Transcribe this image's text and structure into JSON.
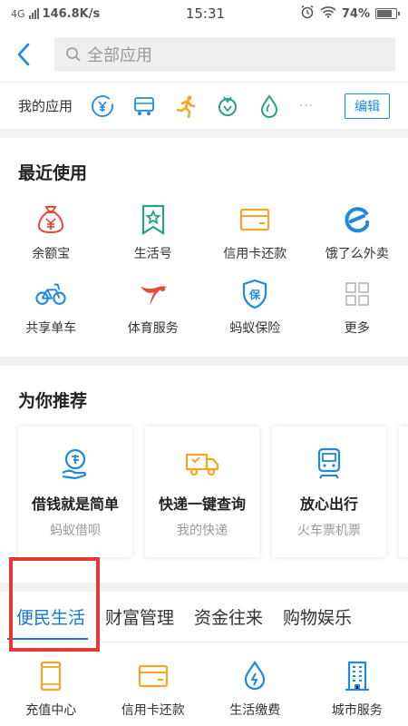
{
  "status": {
    "network": "4G",
    "speed": "146.8K/s",
    "time": "15:31",
    "battery": "74%"
  },
  "header": {
    "search_placeholder": "全部应用"
  },
  "myapps": {
    "label": "我的应用",
    "icons": [
      "yen-icon",
      "bus-card-icon",
      "runner-icon",
      "food-icon",
      "leaf-drop-icon"
    ],
    "more": "···",
    "edit_label": "编辑"
  },
  "recent": {
    "title": "最近使用",
    "items": [
      {
        "label": "余额宝",
        "icon": "money-bag-icon"
      },
      {
        "label": "生活号",
        "icon": "bookmark-star-icon"
      },
      {
        "label": "信用卡还款",
        "icon": "credit-card-icon"
      },
      {
        "label": "饿了么外卖",
        "icon": "eleme-icon"
      },
      {
        "label": "共享单车",
        "icon": "bicycle-icon"
      },
      {
        "label": "体育服务",
        "icon": "sports-icon"
      },
      {
        "label": "蚂蚁保险",
        "icon": "shield-icon"
      },
      {
        "label": "更多",
        "icon": "grid-more-icon"
      }
    ]
  },
  "recommend": {
    "title": "为你推荐",
    "cards": [
      {
        "title": "借钱就是简单",
        "subtitle": "蚂蚁借呗",
        "icon": "loan-hand-icon"
      },
      {
        "title": "快递一键查询",
        "subtitle": "我的快递",
        "icon": "delivery-truck-icon"
      },
      {
        "title": "放心出行",
        "subtitle": "火车票机票",
        "icon": "train-icon"
      }
    ]
  },
  "tabs": [
    {
      "label": "便民生活",
      "active": true
    },
    {
      "label": "财富管理",
      "active": false
    },
    {
      "label": "资金往来",
      "active": false
    },
    {
      "label": "购物娱乐",
      "active": false
    }
  ],
  "services": [
    {
      "label": "充值中心",
      "icon": "phone-topup-icon"
    },
    {
      "label": "信用卡还款",
      "icon": "credit-card-icon"
    },
    {
      "label": "生活缴费",
      "icon": "utility-drop-icon"
    },
    {
      "label": "城市服务",
      "icon": "building-icon"
    }
  ],
  "colors": {
    "accent": "#1e88e5",
    "orange": "#f5a623",
    "red": "#e53935",
    "green": "#25a186"
  }
}
